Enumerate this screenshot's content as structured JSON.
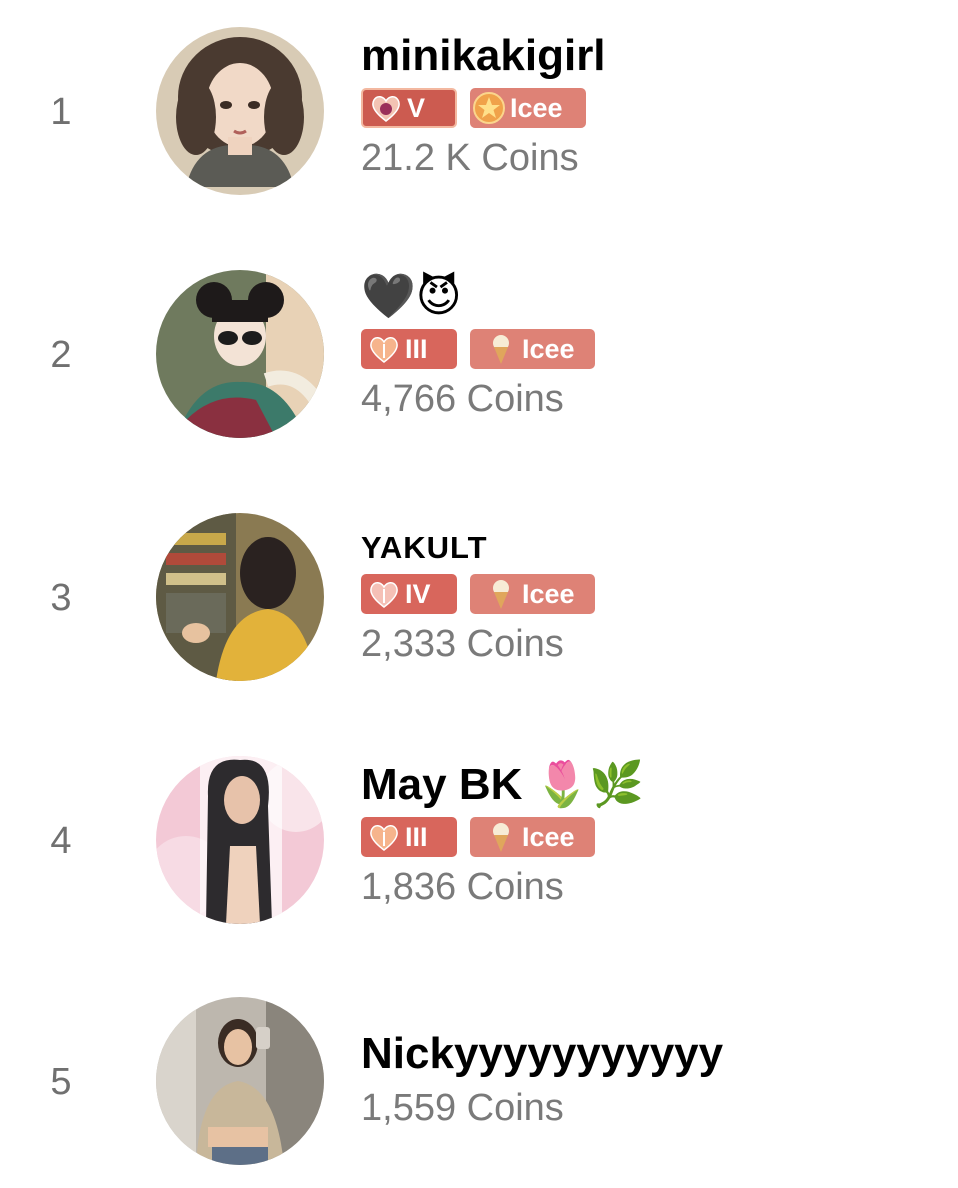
{
  "leaderboard": {
    "entries": [
      {
        "rank": "1",
        "name": "minikakigirl",
        "level_badge": "V",
        "club_badge": "Icee",
        "coins": "21.2 K Coins",
        "avatar": "avatar-girl-curly-hair-illustration"
      },
      {
        "rank": "2",
        "name": "🖤😈",
        "level_badge": "III",
        "club_badge": "Icee",
        "coins": "4,766 Coins",
        "avatar": "avatar-sunglasses-costume-illustration"
      },
      {
        "rank": "3",
        "name": "YAKULT",
        "level_badge": "IV",
        "club_badge": "Icee",
        "coins": "2,333 Coins",
        "avatar": "avatar-person-yellow-jacket-photo"
      },
      {
        "rank": "4",
        "name": "May BK 🌷🌿",
        "level_badge": "III",
        "club_badge": "Icee",
        "coins": "1,836 Coins",
        "avatar": "avatar-woman-pink-background-photo"
      },
      {
        "rank": "5",
        "name": "Nickyyyyyyyyyyy",
        "coins": "1,559 Coins",
        "avatar": "avatar-mirror-selfie-photo"
      }
    ]
  },
  "icons": {
    "level_badge_icon": "heart-level-icon",
    "club_badge_icon": "ice-cream-icon",
    "club_badge_star_icon": "star-medal-icon"
  },
  "colors": {
    "badge_background": "#de8276",
    "level_badge_background": "#d8665c",
    "coins_text": "#7a7a7a",
    "rank_text": "#707070"
  }
}
